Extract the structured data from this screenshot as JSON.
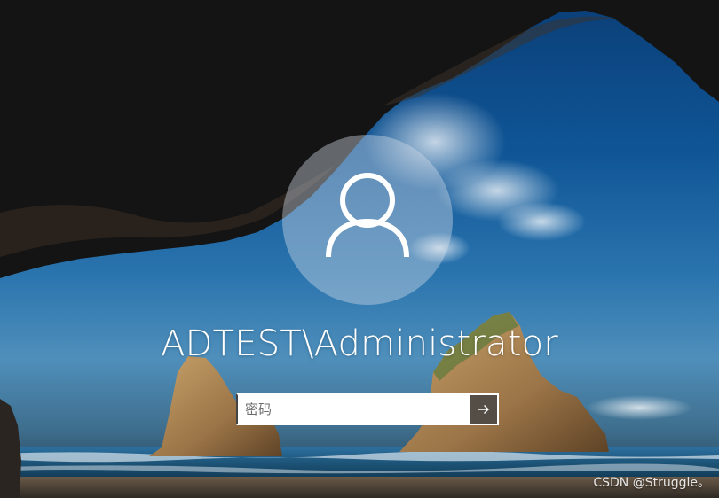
{
  "lock_screen": {
    "username": "ADTEST\\Administrator",
    "password_placeholder": "密码",
    "password_value": "",
    "avatar_icon": "user-icon",
    "submit_icon": "arrow-right-icon"
  },
  "watermark": {
    "text": "CSDN @Struggle。"
  },
  "colors": {
    "sky": "#0f5596",
    "cave": "#141414",
    "avatar_circle": "#c9d3dd",
    "input_bg": "#ffffff",
    "submit_bg": "#464646",
    "text": "#ffffff"
  }
}
